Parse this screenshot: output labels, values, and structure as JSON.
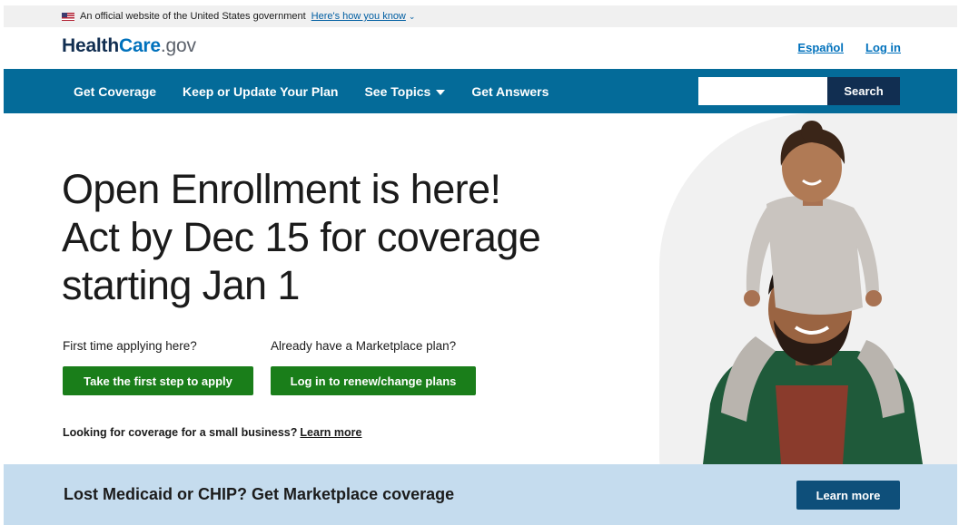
{
  "gov_banner": {
    "text": "An official website of the United States government",
    "link": "Here's how you know"
  },
  "header": {
    "logo": {
      "health": "Health",
      "care": "Care",
      "gov": ".gov"
    },
    "links": [
      "Español",
      "Log in"
    ]
  },
  "nav": {
    "items": [
      "Get Coverage",
      "Keep or Update Your Plan",
      "See Topics",
      "Get Answers"
    ],
    "search_value": "",
    "search_button": "Search"
  },
  "hero": {
    "headline": [
      "Open Enrollment is here!",
      "Act by Dec 15 for coverage",
      "starting Jan 1"
    ],
    "first_time": {
      "prompt": "First time applying here?",
      "button": "Take the first step to apply"
    },
    "existing": {
      "prompt": "Already have a Marketplace plan?",
      "button": "Log in to renew/change plans"
    },
    "small_business": {
      "text": "Looking for coverage for a small business?",
      "link": "Learn more"
    }
  },
  "bottom_banner": {
    "text": "Lost Medicaid or CHIP? Get Marketplace coverage",
    "button": "Learn more"
  },
  "colors": {
    "nav_bg": "#046b99",
    "green_button": "#1a7e1a",
    "bottom_bg": "#c5dcee",
    "link": "#0071bc",
    "dark_navy": "#112e51"
  }
}
